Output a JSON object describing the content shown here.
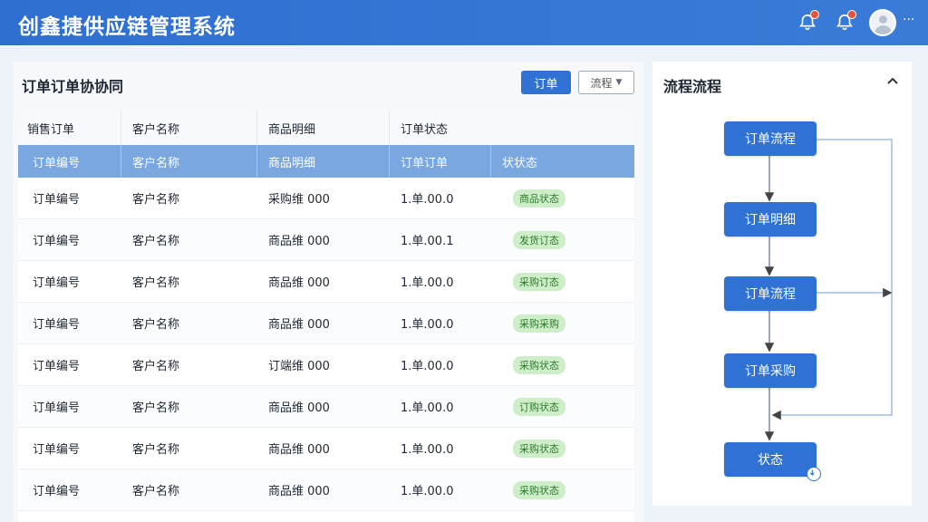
{
  "header": {
    "app_title": "创鑫捷供应链管理系统",
    "notifications": [
      {
        "icon": "bell-icon",
        "badge": true
      },
      {
        "icon": "bell-icon",
        "badge": true
      }
    ],
    "more_label": "···",
    "badge_color": "#e5533d"
  },
  "main": {
    "title": "订单订单协协同",
    "primary_button": "订单",
    "select_button": "流程",
    "columns": [
      "销售订单",
      "客户名称",
      "商品明细",
      "订单状态"
    ],
    "subheader": [
      "订单编号",
      "客户名称",
      "商品明细",
      "订单订单",
      "状状态"
    ],
    "rows": [
      [
        "订单编号",
        "客户名称",
        "采购维 000",
        "1.单.00.0",
        "商品状态"
      ],
      [
        "订单编号",
        "客户名称",
        "商品维 000",
        "1.单.00.1",
        "发货订态"
      ],
      [
        "订单编号",
        "客户名称",
        "商品维 000",
        "1.单.00.0",
        "采购订态"
      ],
      [
        "订单编号",
        "客户名称",
        "商品维 000",
        "1.单.00.0",
        "采购采购"
      ],
      [
        "订单编号",
        "客户名称",
        "订端维 000",
        "1.单.00.0",
        "采购状态"
      ],
      [
        "订单编号",
        "客户名称",
        "商品维 000",
        "1.单.00.0",
        "订购状态"
      ],
      [
        "订单编号",
        "客户名称",
        "商品维 000",
        "1.单.00.0",
        "采购状态"
      ],
      [
        "订单编号",
        "客户名称",
        "商品维 000",
        "1.单.00.0",
        "采购状态"
      ]
    ],
    "accent_color": "#2f72d3",
    "status_color": "#cdeec8"
  },
  "flow": {
    "title": "流程流程",
    "nodes": [
      "订单流程",
      "订单明细",
      "订单流程",
      "订单采购",
      "状态"
    ]
  }
}
